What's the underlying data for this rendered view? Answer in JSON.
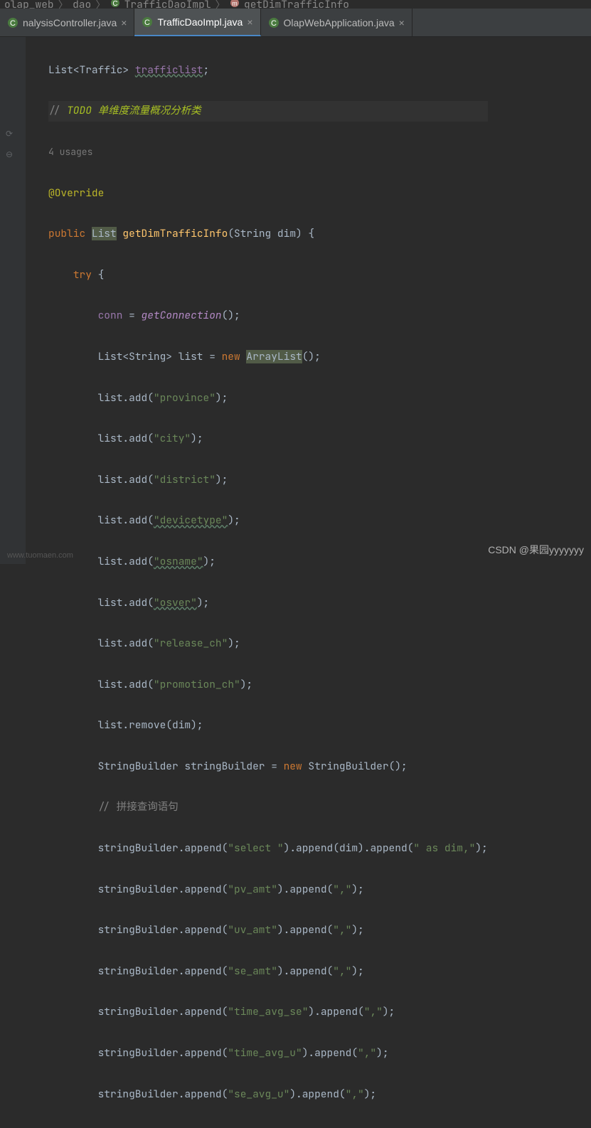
{
  "breadcrumb": {
    "parts": [
      "olap_web",
      "dao",
      "TrafficDaoImpl",
      "getDimTrafficInfo"
    ]
  },
  "tabs": [
    {
      "label": "nalysisController.java",
      "active": false
    },
    {
      "label": "TrafficDaoImpl.java",
      "active": true
    },
    {
      "label": "OlapWebApplication.java",
      "active": false
    }
  ],
  "code": {
    "l1_a": "List<Traffic> ",
    "l1_b": "trafficlist",
    "l1_c": ";",
    "l2_a": "// ",
    "l2_b": "TODO",
    "l2_c": " 单维度流量概况分析类",
    "usages": "4 usages",
    "override": "@Override",
    "pub": "public ",
    "list_t": "List",
    "mname": " getDimTrafficInfo",
    "sig_a": "(String dim) {",
    "try_kw": "try ",
    "try_b": "{",
    "conn": "conn",
    "eq": " = ",
    "getc": "getConnection",
    "pp": "();",
    "ls_decl_a": "List<String> list = ",
    "new": "new ",
    "arraylist": "ArrayList",
    "ppp": "();",
    "ladd": "list.add(",
    "rp": ");",
    "s_prov": "\"province\"",
    "s_city": "\"city\"",
    "s_dist": "\"district\"",
    "s_dev": "\"devicetype\"",
    "s_osn": "\"osname\"",
    "s_osv": "\"osver\"",
    "s_rel": "\"release_ch\"",
    "s_prom": "\"promotion_ch\"",
    "lrem_a": "list.remove(dim);",
    "sb_decl_a": "StringBuilder stringBuilder = ",
    "sb_decl_b": "new ",
    "sb_decl_c": "StringBuilder();",
    "comm2": "// 拼接查询语句",
    "sba": "stringBuilder.append(",
    "s_sel": "\"select \"",
    "app": ").append(",
    "dim": "dim",
    "s_asdim": "\" as dim,\"",
    "s_pv": "\"pv_amt\"",
    "s_uv": "\"uv_amt\"",
    "s_se": "\"se_amt\"",
    "s_tavgse": "\"time_avg_se\"",
    "s_tavgu": "\"time_avg_u\"",
    "s_seavgu": "\"se_avg_u\"",
    "s_comma": "\",\"",
    "semi": ";"
  },
  "watermark": "CSDN @果园yyyyyyy",
  "watermark2": "www.tuomaen.com"
}
